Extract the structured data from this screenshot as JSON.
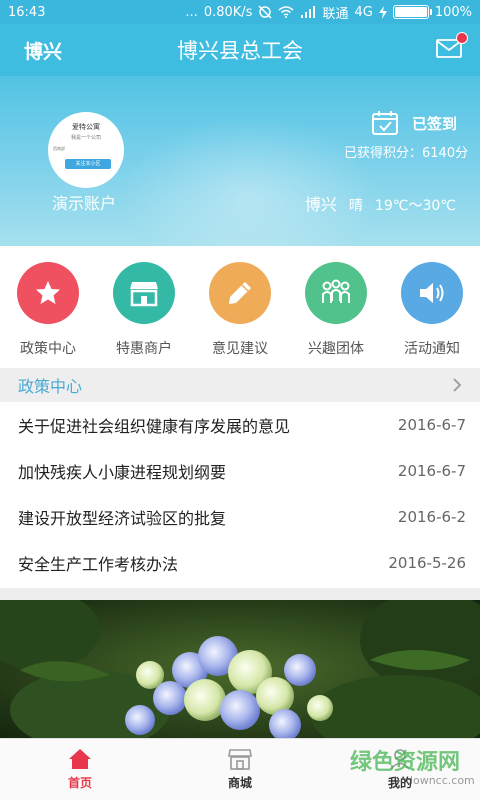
{
  "status_bar": {
    "time": "16:43",
    "dots": "...",
    "speed": "0.80K/s",
    "carrier": "联通",
    "network": "4G",
    "battery_level": 100,
    "battery_text": "100%"
  },
  "header": {
    "location": "博兴",
    "title": "博兴县总工会",
    "mail_icon": "mail-icon",
    "has_badge": true
  },
  "hero": {
    "avatar_text": {
      "title": "爱特公寓",
      "subtitle": "我是一个公司",
      "side": "西南部",
      "button": "关注本小区"
    },
    "account_name": "演示账户",
    "signin_label": "已签到",
    "points": "已获得积分：6140分",
    "weather_city": "博兴",
    "weather_cond": "晴",
    "weather_temp": "19℃～30℃"
  },
  "menu": {
    "items": [
      {
        "label": "政策中心",
        "icon": "star-icon",
        "color": "#ef5160"
      },
      {
        "label": "特惠商户",
        "icon": "shop-icon",
        "color": "#35b9a7"
      },
      {
        "label": "意见建议",
        "icon": "pencil-icon",
        "color": "#f0ab58"
      },
      {
        "label": "兴趣团体",
        "icon": "group-icon",
        "color": "#52c28c"
      },
      {
        "label": "活动通知",
        "icon": "speaker-icon",
        "color": "#58a9e4"
      }
    ]
  },
  "policy": {
    "title": "政策中心",
    "items": [
      {
        "title": "关于促进社会组织健康有序发展的意见",
        "date": "2016-6-7"
      },
      {
        "title": "加快残疾人小康进程规划纲要",
        "date": "2016-6-7"
      },
      {
        "title": "建设开放型经济试验区的批复",
        "date": "2016-6-2"
      },
      {
        "title": "安全生产工作考核办法",
        "date": "2016-5-26"
      }
    ]
  },
  "bottom_nav": {
    "tabs": [
      {
        "label": "首页",
        "icon": "home-icon",
        "active": true
      },
      {
        "label": "商城",
        "icon": "store-icon",
        "active": false
      },
      {
        "label": "我的",
        "icon": "user-icon",
        "active": false
      }
    ]
  },
  "watermark": {
    "main": "绿色资源网",
    "sub": "downcc.com"
  },
  "colors": {
    "primary": "#3fbde0",
    "active_tab": "#e8374a",
    "section_title": "#4aaad6"
  }
}
